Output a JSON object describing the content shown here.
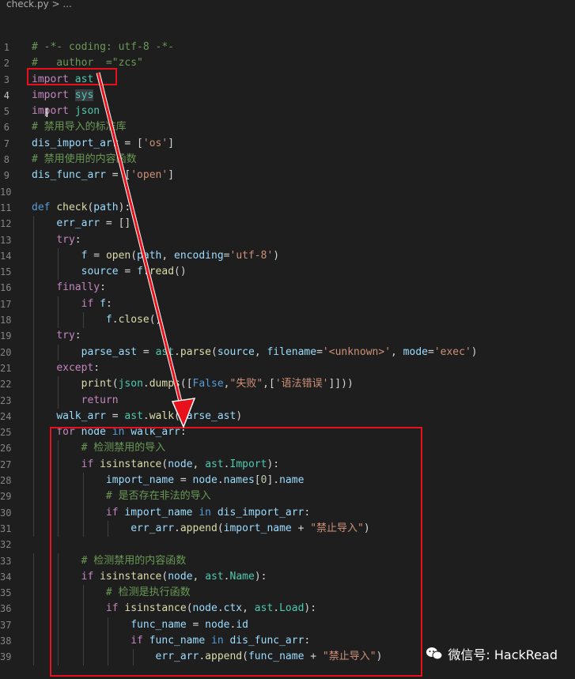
{
  "breadcrumb": {
    "file": "check.py",
    "sep": " > ..."
  },
  "editor": {
    "active_line": "4",
    "lines": [
      {
        "n": "1",
        "segs": [
          {
            "c": "c",
            "t": "# -*- coding: utf-8 -*-"
          }
        ]
      },
      {
        "n": "2",
        "segs": [
          {
            "c": "c",
            "t": "#   author  =\"zcs\""
          }
        ]
      },
      {
        "n": "3",
        "segs": [
          {
            "c": "k",
            "t": "import"
          },
          {
            "c": "p",
            "t": " "
          },
          {
            "c": "t",
            "t": "ast"
          }
        ]
      },
      {
        "n": "4",
        "segs": [
          {
            "c": "k",
            "t": "import"
          },
          {
            "c": "p",
            "t": " "
          },
          {
            "c": "t hl",
            "t": "sys"
          }
        ]
      },
      {
        "n": "5",
        "segs": [
          {
            "c": "k",
            "t": "import"
          },
          {
            "c": "p",
            "t": " "
          },
          {
            "c": "t",
            "t": "json"
          }
        ]
      },
      {
        "n": "6",
        "segs": [
          {
            "c": "c",
            "t": "# 禁用导入的标准库"
          }
        ]
      },
      {
        "n": "7",
        "segs": [
          {
            "c": "v",
            "t": "dis_import_arr"
          },
          {
            "c": "p",
            "t": " = ["
          },
          {
            "c": "s",
            "t": "'os'"
          },
          {
            "c": "p",
            "t": "]"
          }
        ]
      },
      {
        "n": "8",
        "segs": [
          {
            "c": "c",
            "t": "# 禁用使用的内容函数"
          }
        ]
      },
      {
        "n": "9",
        "segs": [
          {
            "c": "v",
            "t": "dis_func_arr"
          },
          {
            "c": "p",
            "t": " = ["
          },
          {
            "c": "s",
            "t": "'open'"
          },
          {
            "c": "p",
            "t": "]"
          }
        ]
      },
      {
        "n": "10",
        "segs": []
      },
      {
        "n": "11",
        "segs": [
          {
            "c": "kd",
            "t": "def"
          },
          {
            "c": "p",
            "t": " "
          },
          {
            "c": "f",
            "t": "check"
          },
          {
            "c": "p",
            "t": "("
          },
          {
            "c": "v",
            "t": "path"
          },
          {
            "c": "p",
            "t": "):"
          }
        ]
      },
      {
        "n": "12",
        "segs": [
          {
            "c": "p",
            "t": "    "
          },
          {
            "c": "v",
            "t": "err_arr"
          },
          {
            "c": "p",
            "t": " = []"
          }
        ]
      },
      {
        "n": "13",
        "segs": [
          {
            "c": "p",
            "t": "    "
          },
          {
            "c": "k",
            "t": "try"
          },
          {
            "c": "p",
            "t": ":"
          }
        ]
      },
      {
        "n": "14",
        "segs": [
          {
            "c": "p",
            "t": "        "
          },
          {
            "c": "v",
            "t": "f"
          },
          {
            "c": "p",
            "t": " = "
          },
          {
            "c": "f",
            "t": "open"
          },
          {
            "c": "p",
            "t": "("
          },
          {
            "c": "v",
            "t": "path"
          },
          {
            "c": "p",
            "t": ", "
          },
          {
            "c": "v",
            "t": "encoding"
          },
          {
            "c": "p",
            "t": "="
          },
          {
            "c": "s",
            "t": "'utf-8'"
          },
          {
            "c": "p",
            "t": ")"
          }
        ]
      },
      {
        "n": "15",
        "segs": [
          {
            "c": "p",
            "t": "        "
          },
          {
            "c": "v",
            "t": "source"
          },
          {
            "c": "p",
            "t": " = "
          },
          {
            "c": "v",
            "t": "f"
          },
          {
            "c": "p",
            "t": "."
          },
          {
            "c": "f",
            "t": "read"
          },
          {
            "c": "p",
            "t": "()"
          }
        ]
      },
      {
        "n": "16",
        "segs": [
          {
            "c": "p",
            "t": "    "
          },
          {
            "c": "k",
            "t": "finally"
          },
          {
            "c": "p",
            "t": ":"
          }
        ]
      },
      {
        "n": "17",
        "segs": [
          {
            "c": "p",
            "t": "        "
          },
          {
            "c": "k",
            "t": "if"
          },
          {
            "c": "p",
            "t": " "
          },
          {
            "c": "v",
            "t": "f"
          },
          {
            "c": "p",
            "t": ":"
          }
        ]
      },
      {
        "n": "18",
        "segs": [
          {
            "c": "p",
            "t": "            "
          },
          {
            "c": "v",
            "t": "f"
          },
          {
            "c": "p",
            "t": "."
          },
          {
            "c": "f",
            "t": "close"
          },
          {
            "c": "p",
            "t": "()"
          }
        ]
      },
      {
        "n": "19",
        "segs": [
          {
            "c": "p",
            "t": "    "
          },
          {
            "c": "k",
            "t": "try"
          },
          {
            "c": "p",
            "t": ":"
          }
        ]
      },
      {
        "n": "20",
        "segs": [
          {
            "c": "p",
            "t": "        "
          },
          {
            "c": "v",
            "t": "parse_ast"
          },
          {
            "c": "p",
            "t": " = "
          },
          {
            "c": "t",
            "t": "ast"
          },
          {
            "c": "p",
            "t": "."
          },
          {
            "c": "f",
            "t": "parse"
          },
          {
            "c": "p",
            "t": "("
          },
          {
            "c": "v",
            "t": "source"
          },
          {
            "c": "p",
            "t": ", "
          },
          {
            "c": "v",
            "t": "filename"
          },
          {
            "c": "p",
            "t": "="
          },
          {
            "c": "s",
            "t": "'<unknown>'"
          },
          {
            "c": "p",
            "t": ", "
          },
          {
            "c": "v",
            "t": "mode"
          },
          {
            "c": "p",
            "t": "="
          },
          {
            "c": "s",
            "t": "'exec'"
          },
          {
            "c": "p",
            "t": ")"
          }
        ]
      },
      {
        "n": "21",
        "segs": [
          {
            "c": "p",
            "t": "    "
          },
          {
            "c": "k",
            "t": "except"
          },
          {
            "c": "p",
            "t": ":"
          }
        ]
      },
      {
        "n": "22",
        "segs": [
          {
            "c": "p",
            "t": "        "
          },
          {
            "c": "f",
            "t": "print"
          },
          {
            "c": "p",
            "t": "("
          },
          {
            "c": "t",
            "t": "json"
          },
          {
            "c": "p",
            "t": "."
          },
          {
            "c": "f",
            "t": "dumps"
          },
          {
            "c": "p",
            "t": "(["
          },
          {
            "c": "kd",
            "t": "False"
          },
          {
            "c": "p",
            "t": ","
          },
          {
            "c": "s",
            "t": "\"失败\""
          },
          {
            "c": "p",
            "t": ",["
          },
          {
            "c": "s",
            "t": "'语法错误'"
          },
          {
            "c": "p",
            "t": "]]))"
          }
        ]
      },
      {
        "n": "23",
        "segs": [
          {
            "c": "p",
            "t": "        "
          },
          {
            "c": "k",
            "t": "return"
          }
        ]
      },
      {
        "n": "24",
        "segs": [
          {
            "c": "p",
            "t": "    "
          },
          {
            "c": "v",
            "t": "walk_arr"
          },
          {
            "c": "p",
            "t": " = "
          },
          {
            "c": "t",
            "t": "ast"
          },
          {
            "c": "p",
            "t": "."
          },
          {
            "c": "f",
            "t": "walk"
          },
          {
            "c": "p",
            "t": "("
          },
          {
            "c": "v",
            "t": "parse_ast"
          },
          {
            "c": "p",
            "t": ")"
          }
        ]
      },
      {
        "n": "25",
        "segs": [
          {
            "c": "p",
            "t": "    "
          },
          {
            "c": "k",
            "t": "for"
          },
          {
            "c": "p",
            "t": " "
          },
          {
            "c": "v",
            "t": "node"
          },
          {
            "c": "p",
            "t": " "
          },
          {
            "c": "kd",
            "t": "in"
          },
          {
            "c": "p",
            "t": " "
          },
          {
            "c": "v",
            "t": "walk_arr"
          },
          {
            "c": "p",
            "t": ":"
          }
        ]
      },
      {
        "n": "26",
        "segs": [
          {
            "c": "p",
            "t": "        "
          },
          {
            "c": "c",
            "t": "# 检测禁用的导入"
          }
        ]
      },
      {
        "n": "27",
        "segs": [
          {
            "c": "p",
            "t": "        "
          },
          {
            "c": "k",
            "t": "if"
          },
          {
            "c": "p",
            "t": " "
          },
          {
            "c": "f",
            "t": "isinstance"
          },
          {
            "c": "p",
            "t": "("
          },
          {
            "c": "v",
            "t": "node"
          },
          {
            "c": "p",
            "t": ", "
          },
          {
            "c": "t",
            "t": "ast"
          },
          {
            "c": "p",
            "t": "."
          },
          {
            "c": "t",
            "t": "Import"
          },
          {
            "c": "p",
            "t": "):"
          }
        ]
      },
      {
        "n": "28",
        "segs": [
          {
            "c": "p",
            "t": "            "
          },
          {
            "c": "v",
            "t": "import_name"
          },
          {
            "c": "p",
            "t": " = "
          },
          {
            "c": "v",
            "t": "node"
          },
          {
            "c": "p",
            "t": "."
          },
          {
            "c": "v",
            "t": "names"
          },
          {
            "c": "p",
            "t": "["
          },
          {
            "c": "n",
            "t": "0"
          },
          {
            "c": "p",
            "t": "]."
          },
          {
            "c": "v",
            "t": "name"
          }
        ]
      },
      {
        "n": "29",
        "segs": [
          {
            "c": "p",
            "t": "            "
          },
          {
            "c": "c",
            "t": "# 是否存在非法的导入"
          }
        ]
      },
      {
        "n": "30",
        "segs": [
          {
            "c": "p",
            "t": "            "
          },
          {
            "c": "k",
            "t": "if"
          },
          {
            "c": "p",
            "t": " "
          },
          {
            "c": "v",
            "t": "import_name"
          },
          {
            "c": "p",
            "t": " "
          },
          {
            "c": "kd",
            "t": "in"
          },
          {
            "c": "p",
            "t": " "
          },
          {
            "c": "v",
            "t": "dis_import_arr"
          },
          {
            "c": "p",
            "t": ":"
          }
        ]
      },
      {
        "n": "31",
        "segs": [
          {
            "c": "p",
            "t": "                "
          },
          {
            "c": "v",
            "t": "err_arr"
          },
          {
            "c": "p",
            "t": "."
          },
          {
            "c": "f",
            "t": "append"
          },
          {
            "c": "p",
            "t": "("
          },
          {
            "c": "v",
            "t": "import_name"
          },
          {
            "c": "p",
            "t": " + "
          },
          {
            "c": "s",
            "t": "\"禁止导入\""
          },
          {
            "c": "p",
            "t": ")"
          }
        ]
      },
      {
        "n": "32",
        "segs": []
      },
      {
        "n": "33",
        "segs": [
          {
            "c": "p",
            "t": "        "
          },
          {
            "c": "c",
            "t": "# 检测禁用的内容函数"
          }
        ]
      },
      {
        "n": "34",
        "segs": [
          {
            "c": "p",
            "t": "        "
          },
          {
            "c": "k",
            "t": "if"
          },
          {
            "c": "p",
            "t": " "
          },
          {
            "c": "f",
            "t": "isinstance"
          },
          {
            "c": "p",
            "t": "("
          },
          {
            "c": "v",
            "t": "node"
          },
          {
            "c": "p",
            "t": ", "
          },
          {
            "c": "t",
            "t": "ast"
          },
          {
            "c": "p",
            "t": "."
          },
          {
            "c": "t",
            "t": "Name"
          },
          {
            "c": "p",
            "t": "):"
          }
        ]
      },
      {
        "n": "35",
        "segs": [
          {
            "c": "p",
            "t": "            "
          },
          {
            "c": "c",
            "t": "# 检测是执行函数"
          }
        ]
      },
      {
        "n": "36",
        "segs": [
          {
            "c": "p",
            "t": "            "
          },
          {
            "c": "k",
            "t": "if"
          },
          {
            "c": "p",
            "t": " "
          },
          {
            "c": "f",
            "t": "isinstance"
          },
          {
            "c": "p",
            "t": "("
          },
          {
            "c": "v",
            "t": "node"
          },
          {
            "c": "p",
            "t": "."
          },
          {
            "c": "v",
            "t": "ctx"
          },
          {
            "c": "p",
            "t": ", "
          },
          {
            "c": "t",
            "t": "ast"
          },
          {
            "c": "p",
            "t": "."
          },
          {
            "c": "t",
            "t": "Load"
          },
          {
            "c": "p",
            "t": "):"
          }
        ]
      },
      {
        "n": "37",
        "segs": [
          {
            "c": "p",
            "t": "                "
          },
          {
            "c": "v",
            "t": "func_name"
          },
          {
            "c": "p",
            "t": " = "
          },
          {
            "c": "v",
            "t": "node"
          },
          {
            "c": "p",
            "t": "."
          },
          {
            "c": "v",
            "t": "id"
          }
        ]
      },
      {
        "n": "38",
        "segs": [
          {
            "c": "p",
            "t": "                "
          },
          {
            "c": "k",
            "t": "if"
          },
          {
            "c": "p",
            "t": " "
          },
          {
            "c": "v",
            "t": "func_name"
          },
          {
            "c": "p",
            "t": " "
          },
          {
            "c": "kd",
            "t": "in"
          },
          {
            "c": "p",
            "t": " "
          },
          {
            "c": "v",
            "t": "dis_func_arr"
          },
          {
            "c": "p",
            "t": ":"
          }
        ]
      },
      {
        "n": "39",
        "segs": [
          {
            "c": "p",
            "t": "                    "
          },
          {
            "c": "v",
            "t": "err_arr"
          },
          {
            "c": "p",
            "t": "."
          },
          {
            "c": "f",
            "t": "append"
          },
          {
            "c": "p",
            "t": "("
          },
          {
            "c": "v",
            "t": "func_name"
          },
          {
            "c": "p",
            "t": " + "
          },
          {
            "c": "s",
            "t": "\"禁止导入\""
          },
          {
            "c": "p",
            "t": ")"
          }
        ]
      }
    ]
  },
  "watermark": {
    "text": "微信号: HackRead",
    "icon": "wechat-icon"
  },
  "colors": {
    "annotation": "#e8101a",
    "background": "#1e1e1e"
  }
}
